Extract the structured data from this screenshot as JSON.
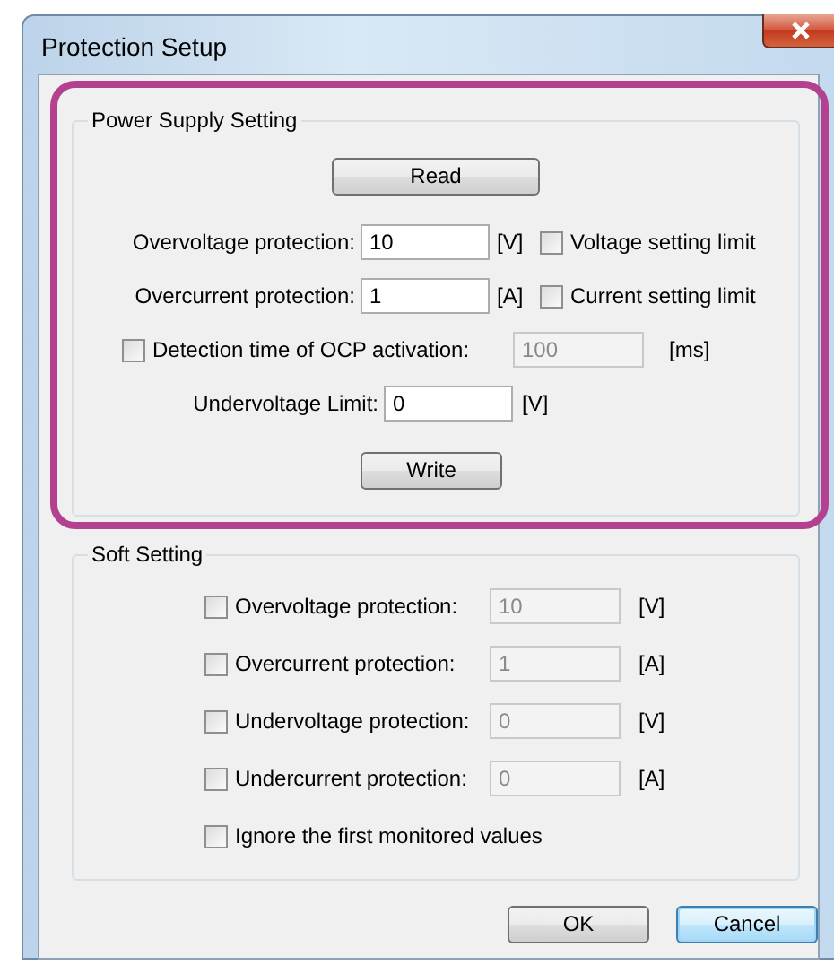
{
  "window": {
    "title": "Protection Setup"
  },
  "power_supply_setting": {
    "title": "Power Supply Setting",
    "read_button": "Read",
    "rows": [
      {
        "kind": "limit_field",
        "label": "Overvoltage protection:",
        "value": "10",
        "unit": "[V]",
        "limit_label": "Voltage setting limit",
        "limit_checked": false
      },
      {
        "kind": "limit_field",
        "label": "Overcurrent protection:",
        "value": "1",
        "unit": "[A]",
        "limit_label": "Current setting limit",
        "limit_checked": false
      },
      {
        "kind": "check_field",
        "label": "Detection time of OCP activation:",
        "checked": false,
        "value": "100",
        "unit": "[ms]",
        "disabled": true
      },
      {
        "kind": "field",
        "label": "Undervoltage Limit:",
        "value": "0",
        "unit": "[V]"
      }
    ],
    "write_button": "Write"
  },
  "soft_setting": {
    "title": "Soft Setting",
    "rows": [
      {
        "kind": "check_field",
        "label": "Overvoltage protection:",
        "checked": false,
        "value": "10",
        "unit": "[V]",
        "disabled": true
      },
      {
        "kind": "check_field",
        "label": "Overcurrent protection:",
        "checked": false,
        "value": "1",
        "unit": "[A]",
        "disabled": true
      },
      {
        "kind": "check_field",
        "label": "Undervoltage protection:",
        "checked": false,
        "value": "0",
        "unit": "[V]",
        "disabled": true
      },
      {
        "kind": "check_field",
        "label": "Undercurrent protection:",
        "checked": false,
        "value": "0",
        "unit": "[A]",
        "disabled": true
      },
      {
        "kind": "check",
        "label": "Ignore the first monitored values",
        "checked": false
      }
    ]
  },
  "buttons": [
    {
      "label": "OK",
      "default": false
    },
    {
      "label": "Cancel",
      "default": true
    }
  ]
}
